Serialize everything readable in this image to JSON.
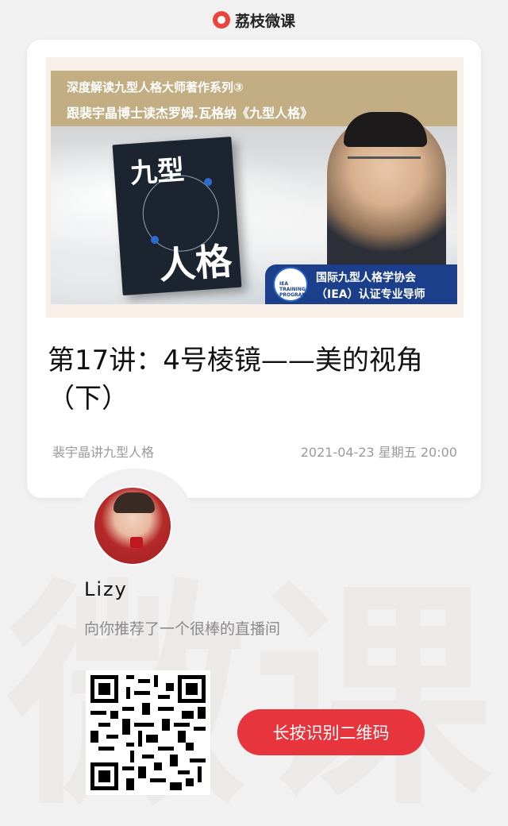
{
  "brand": {
    "logo_text": "荔枝微课",
    "accent": "#e8343c"
  },
  "watermark": {
    "text": "微课"
  },
  "card": {
    "banner": {
      "line1": "深度解读九型人格大师著作系列③",
      "line2": "跟裴宇晶博士读杰罗姆.瓦格纳《九型人格》",
      "book_title_top": "九型",
      "book_title_bottom": "人格",
      "badge_text": "IEA TRAINING PROGRAM",
      "foot_line1": "国际九型人格学协会",
      "foot_line2": "（IEA）认证专业导师"
    },
    "lesson_title": "第17讲：4号棱镜——美的视角（下）",
    "channel": "裴宇晶讲九型人格",
    "datetime": "2021-04-23 星期五 20:00"
  },
  "sharer": {
    "avatar_icon": "avatar-photo",
    "name": "Lizy",
    "recommend_text": "向你推荐了一个很棒的直播间"
  },
  "qr": {
    "icon": "qr-code-icon"
  },
  "cta": {
    "label": "长按识别二维码"
  }
}
